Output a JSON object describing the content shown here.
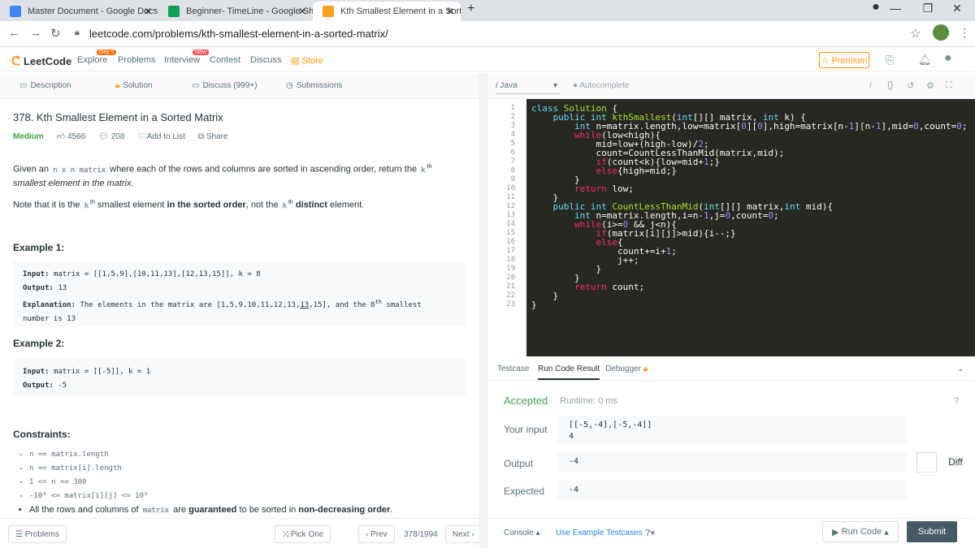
{
  "browser": {
    "tabs": [
      {
        "title": "Master Document - Google Docs",
        "favicon_color": "#4285f4"
      },
      {
        "title": "Beginner- TimeLine - Google She",
        "favicon_color": "#0f9d58"
      },
      {
        "title": "Kth Smallest Element in a Sorted",
        "favicon_color": "#f89f1b"
      }
    ],
    "new_tab_icon": "+",
    "url": "leetcode.com/problems/kth-smallest-element-in-a-sorted-matrix/"
  },
  "nav": {
    "logo": "LeetCode",
    "explore": "Explore",
    "explore_badge": "Day 5",
    "problems": "Problems",
    "interview": "Interview",
    "contest_badge": "New",
    "contest": "Contest",
    "discuss": "Discuss",
    "store": "Store",
    "premium": "☆ Premium"
  },
  "left_tabs": {
    "description": "Description",
    "solution": "Solution",
    "discuss": "Discuss (999+)",
    "submissions": "Submissions"
  },
  "problem": {
    "title": "378. Kth Smallest Element in a Sorted Matrix",
    "difficulty": "Medium",
    "likes": "4566",
    "dislikes": "208",
    "add_to_list": "Add to List",
    "share": "Share",
    "desc_1a": "Given an ",
    "desc_1_code": "n x n matrix",
    "desc_1b": " where each of the rows and columns are sorted in ascending order, return the ",
    "desc_1_k": "k",
    "desc_1_th": "th",
    "desc_1c": "smallest element in the matrix.",
    "note_a": "Note that it is the ",
    "note_k": "k",
    "note_th": "th",
    "note_b": " smallest element ",
    "note_bold": "in the sorted order",
    "note_c": ", not the ",
    "note_k2": "k",
    "note_th2": "th",
    "note_bold2": " distinct",
    "note_d": " element.",
    "example1_heading": "Example 1:",
    "example1_input_label": "Input:",
    "example1_input": "matrix = [[1,5,9],[10,11,13],[12,13,15]], k = 8",
    "example1_output_label": "Output:",
    "example1_output": "13",
    "example1_expl_label": "Explanation:",
    "example1_expl_a": "The elements in the matrix are [1,5,9,10,11,12,13,",
    "example1_expl_u": "13",
    "example1_expl_b": ",15], and the 8",
    "example1_expl_th": "th",
    "example1_expl_c": " smallest",
    "example1_expl_d": "number is 13",
    "example2_heading": "Example 2:",
    "example2_input_label": "Input:",
    "example2_input": "matrix = [[-5]], k = 1",
    "example2_output_label": "Output:",
    "example2_output": "-5",
    "constraints_heading": "Constraints:",
    "constraints": [
      "n == matrix.length",
      "n == matrix[i].length",
      "1 <= n <= 300",
      "-10⁹ <= matrix[i][j] <= 10⁹"
    ],
    "constraint_last_a": "All the rows and columns of ",
    "constraint_last_code": "matrix",
    "constraint_last_b": " are ",
    "constraint_last_bold": "guaranteed",
    "constraint_last_c": " to be sorted in ",
    "constraint_last_bold2": "non-decreasing order",
    "constraint_last_d": "."
  },
  "left_footer": {
    "problems": "Problems",
    "pick_one": "Pick One",
    "prev": "Prev",
    "counter": "378/1994",
    "next": "Next"
  },
  "editor": {
    "language": "Java",
    "autocomplete": "Autocomplete",
    "line_numbers": [
      "1",
      "2",
      "3",
      "4",
      "5",
      "6",
      "7",
      "8",
      "9",
      "10",
      "11",
      "12",
      "13",
      "14",
      "15",
      "16",
      "17",
      "18",
      "19",
      "20",
      "21",
      "22",
      "23"
    ]
  },
  "result": {
    "tab_testcase": "Testcase",
    "tab_run_result": "Run Code Result",
    "tab_debugger": "Debugger",
    "status": "Accepted",
    "runtime": "Runtime: 0 ms",
    "your_input_label": "Your input",
    "your_input_line1": "[[-5,-4],[-5,-4]]",
    "your_input_line2": "4",
    "output_label": "Output",
    "output_value": "-4",
    "expected_label": "Expected",
    "expected_value": "-4",
    "diff": "Diff"
  },
  "right_footer": {
    "console": "Console",
    "use_example": "Use Example Testcases",
    "run_code": "Run Code",
    "submit": "Submit"
  }
}
